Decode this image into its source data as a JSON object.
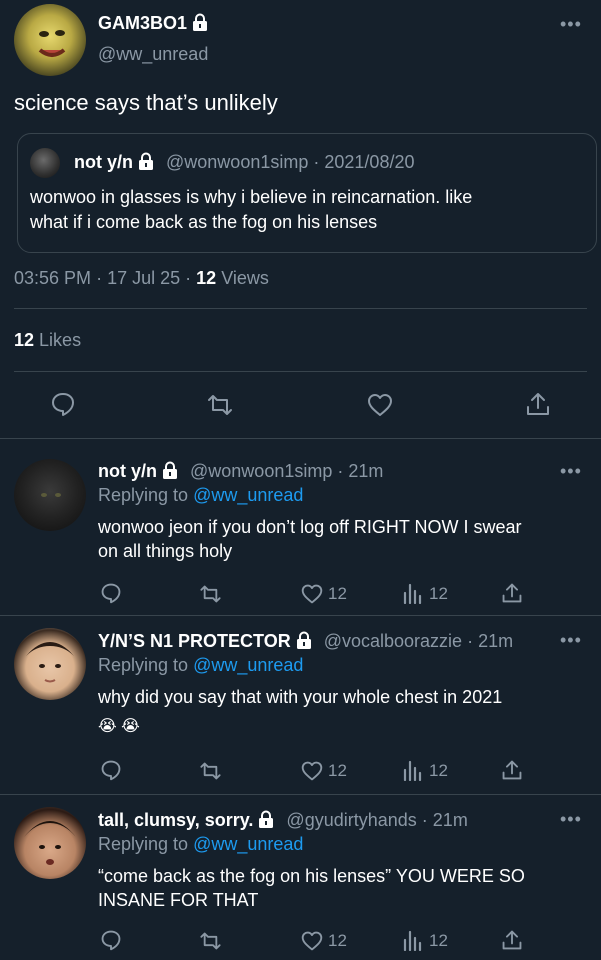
{
  "main_tweet": {
    "display_name": "GAM3BO1",
    "handle": "@ww_unread",
    "text": "science says that’s unlikely",
    "quote": {
      "display_name": "not y/n",
      "handle": "@wonwoon1simp",
      "separator": "·",
      "date": "2021/08/20",
      "text_line1": "wonwoo in glasses is why i believe in reincarnation. like",
      "text_line2": "what if i come back as the fog on his lenses"
    },
    "time": "03:56 PM",
    "date": "17 Jul 25",
    "views_count": "12",
    "views_label": "Views",
    "likes_count": "12",
    "likes_label": "Likes",
    "actions": [
      "reply-icon",
      "retweet-icon",
      "like-icon",
      "share-icon"
    ]
  },
  "replies": [
    {
      "display_name": "not y/n",
      "handle": "@wonwoon1simp",
      "time": "21m",
      "replying_prefix": "Replying to",
      "replying_to": "@ww_unread",
      "line1": "wonwoo jeon if you don’t log off RIGHT NOW I swear",
      "line2": "on all things holy",
      "likes": "12",
      "views": "12"
    },
    {
      "display_name": "Y/N’S N1 PROTECTOR",
      "handle": "@vocalboorazzie",
      "time": "21m",
      "replying_prefix": "Replying to",
      "replying_to": "@ww_unread",
      "line1": "why did you say that with your whole chest in 2021",
      "line2": "😭 😭",
      "likes": "12",
      "views": "12"
    },
    {
      "display_name": "tall, clumsy, sorry.",
      "handle": "@gyudirtyhands",
      "time": "21m",
      "replying_prefix": "Replying to",
      "replying_to": "@ww_unread",
      "line1": "“come back as the fog on his lenses” YOU WERE SO",
      "line2": "INSANE FOR THAT",
      "likes": "12",
      "views": "12"
    }
  ],
  "colors": {
    "background": "#15202b",
    "muted": "#8b98a5",
    "link": "#1d9bf0",
    "divider": "#38444d"
  }
}
